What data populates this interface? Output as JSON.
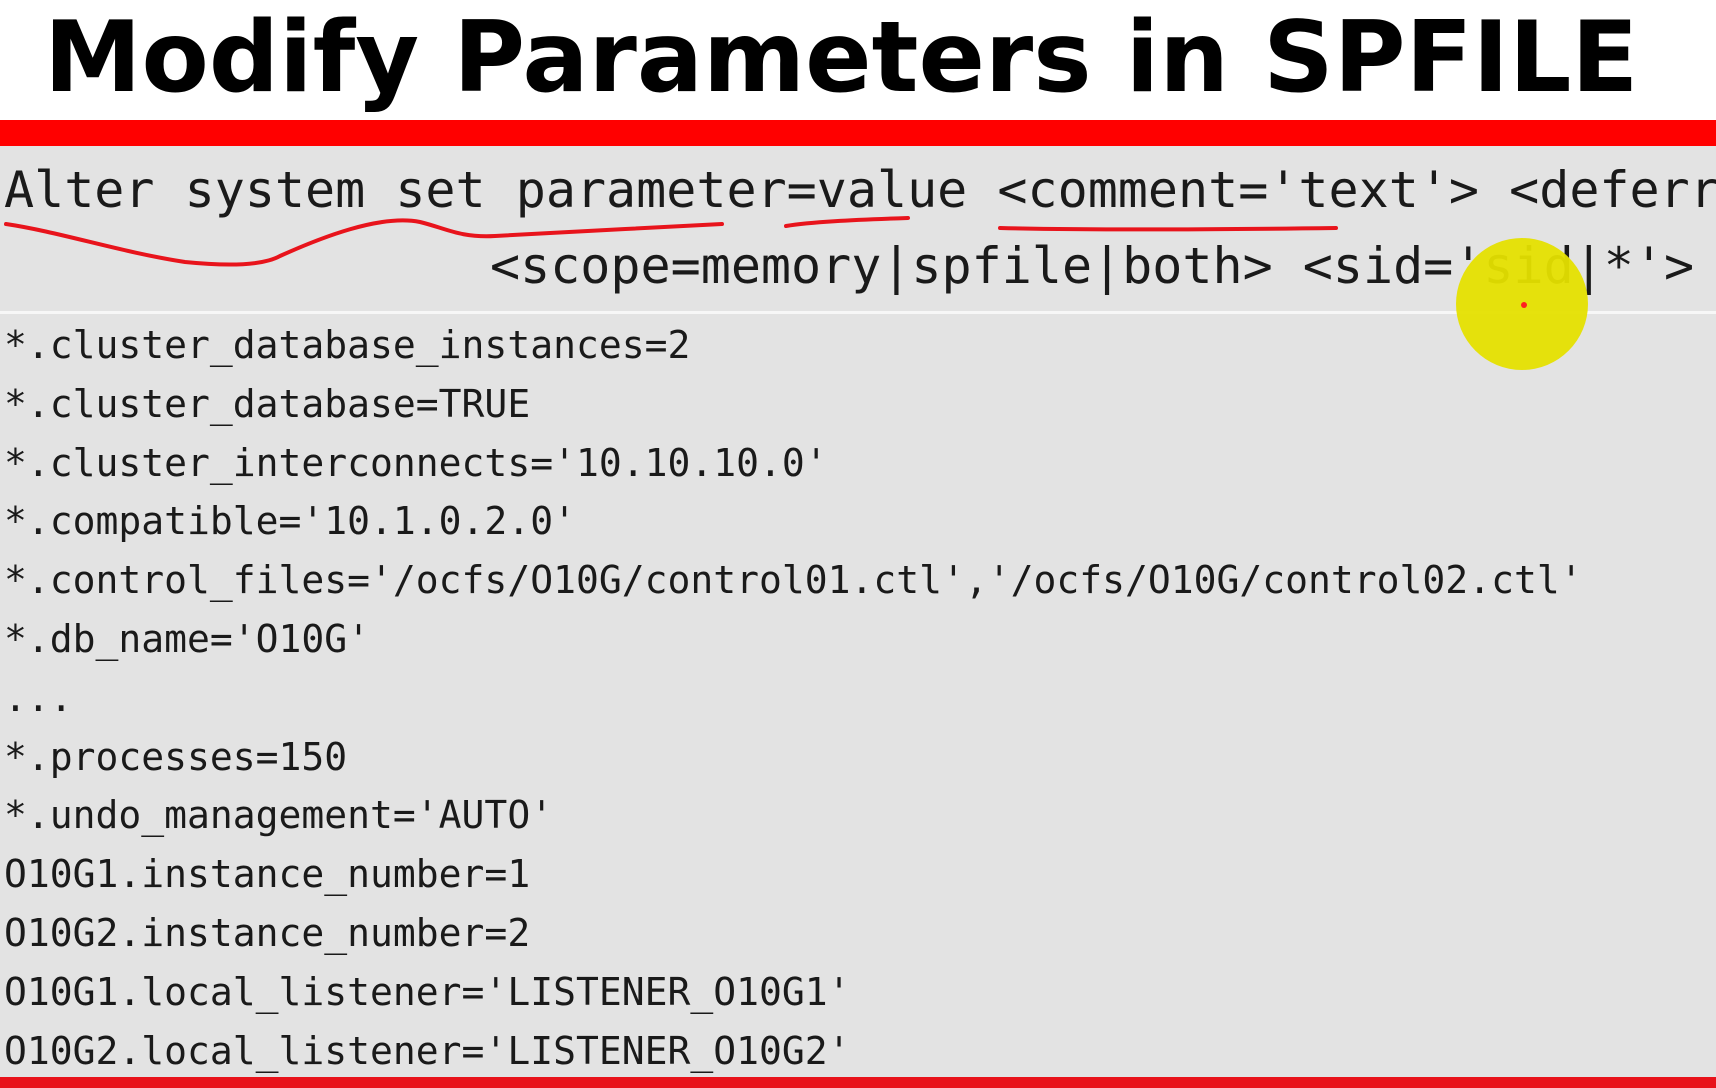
{
  "slide": {
    "title": "Modify Parameters in SPFILE",
    "syntax": {
      "line1": "Alter system set parameter=value <comment='text'> <deferred>",
      "line2": "<scope=memory|spfile|both> <sid='sid|*'>"
    },
    "parameters": [
      "*.cluster_database_instances=2",
      "*.cluster_database=TRUE",
      "*.cluster_interconnects='10.10.10.0'",
      "*.compatible='10.1.0.2.0'",
      "*.control_files='/ocfs/O10G/control01.ctl','/ocfs/O10G/control02.ctl'",
      "*.db_name='O10G'",
      "...",
      "*.processes=150",
      "*.undo_management='AUTO'",
      "O10G1.instance_number=1",
      "O10G2.instance_number=2",
      "O10G1.local_listener='LISTENER_O10G1'",
      "O10G2.local_listener='LISTENER_O10G2'"
    ]
  },
  "colors": {
    "title_text": "#000000",
    "accent_red": "#ff0000",
    "background": "#e3e3e3",
    "annotation_ink": "#e8141c",
    "pointer_highlight": "#e5e000"
  },
  "icons": {
    "pointer": "cursor-highlight-icon"
  }
}
